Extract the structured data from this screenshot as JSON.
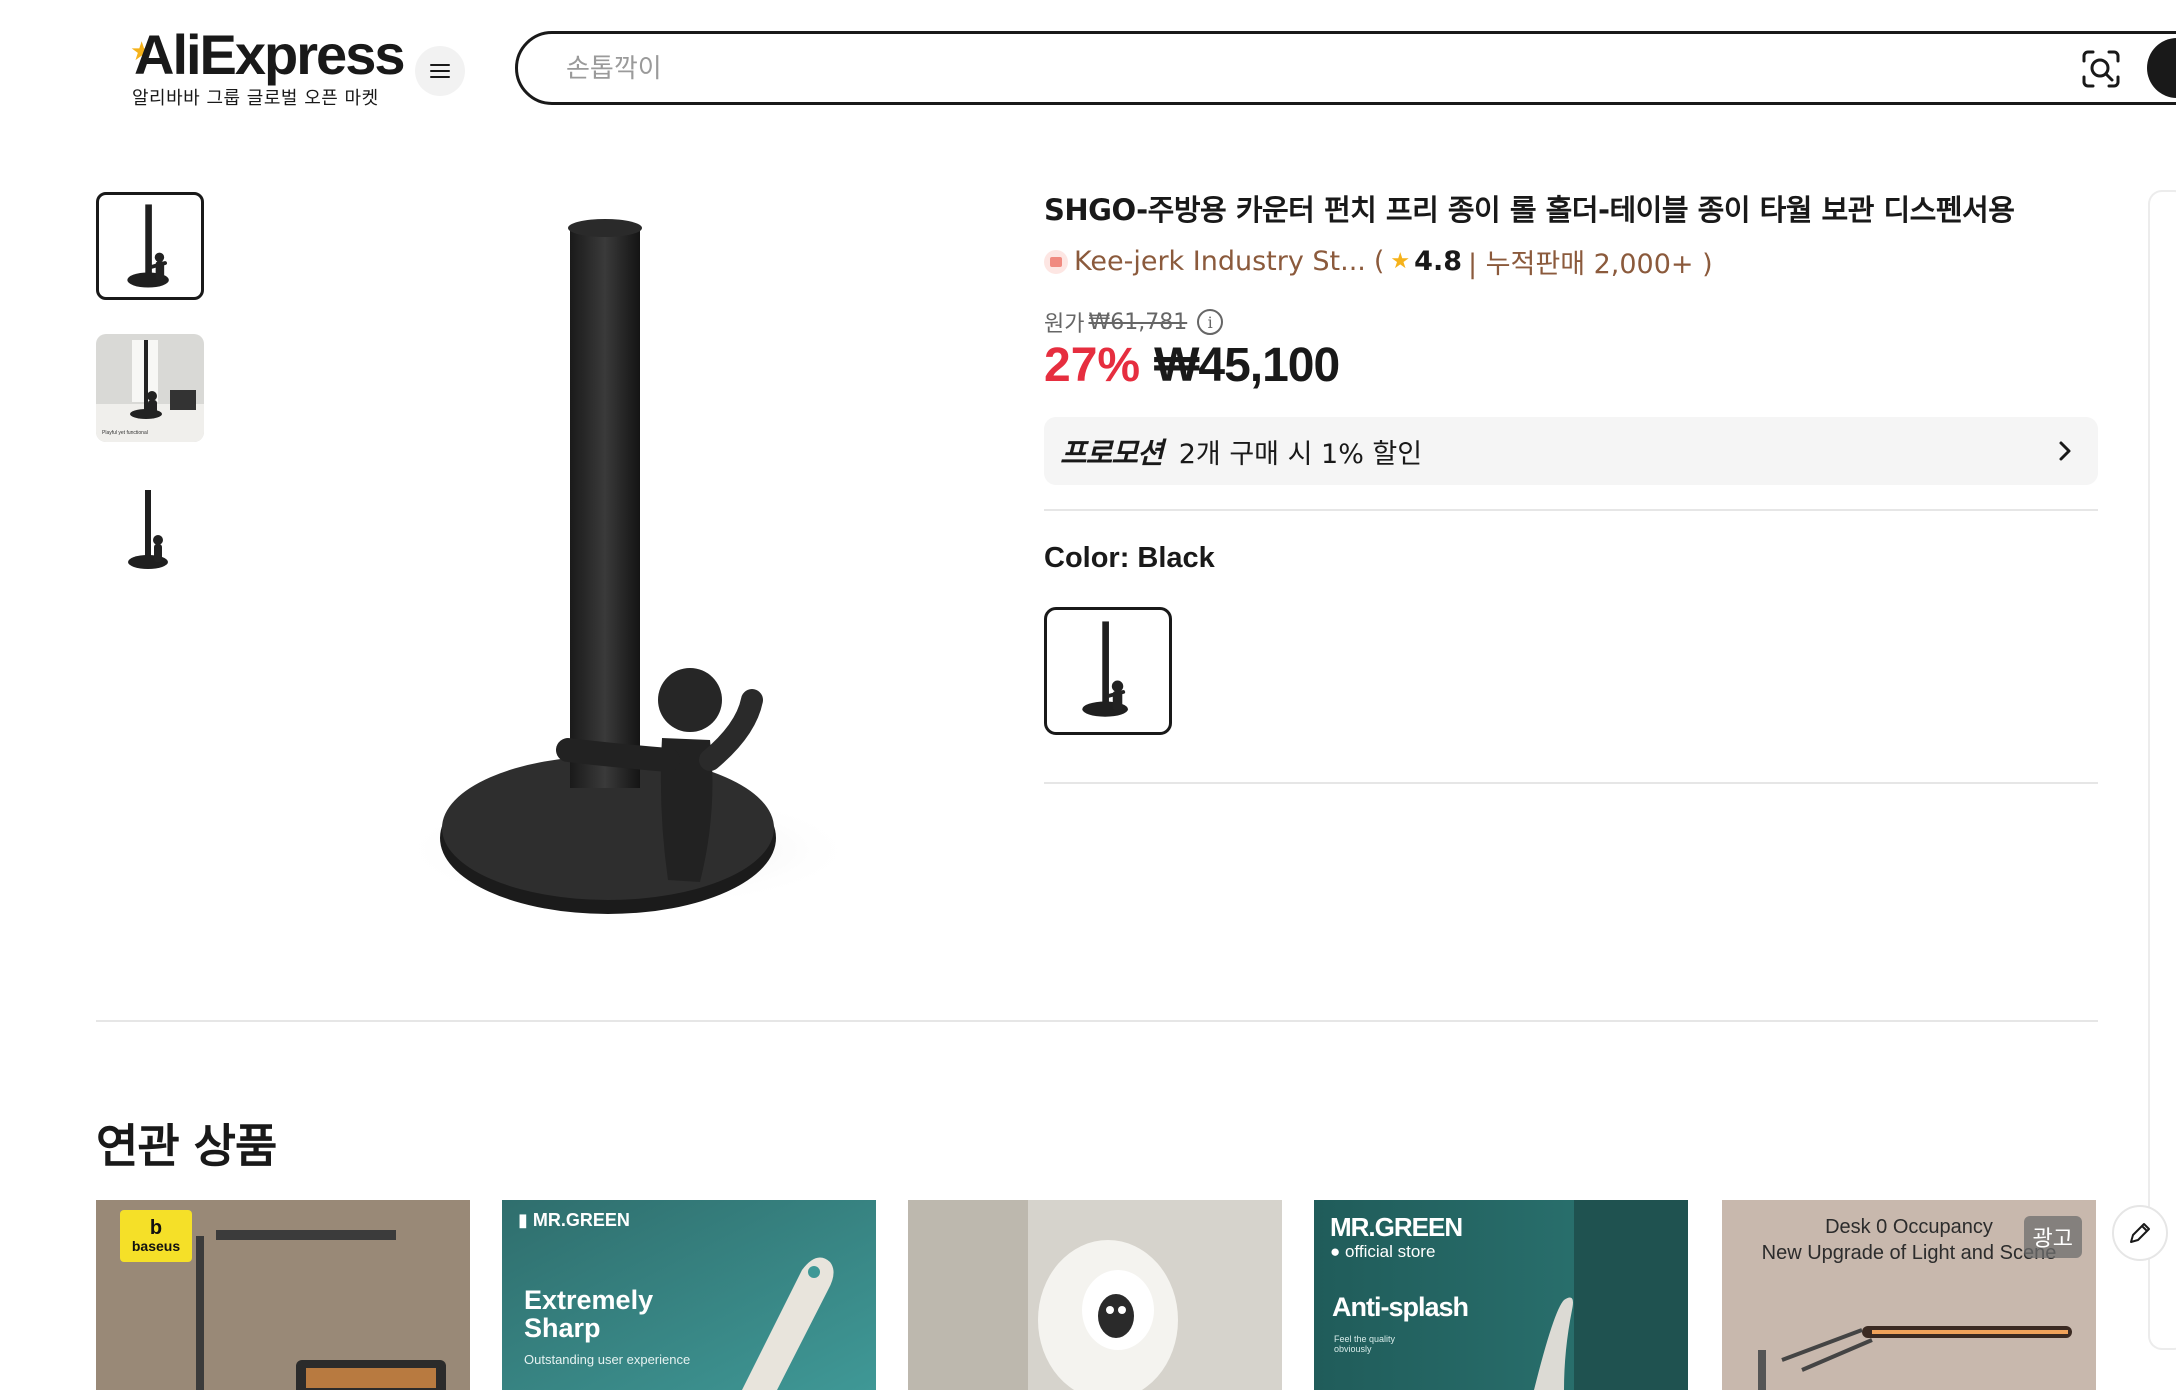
{
  "header": {
    "logo_text": "AliExpress",
    "logo_subtitle": "알리바바 그룹 글로벌 오픈 마켓",
    "menu_icon": "hamburger-menu-icon",
    "search": {
      "placeholder": "손톱깍이",
      "value": ""
    },
    "camera_icon": "image-search-icon"
  },
  "thumbnails": [
    {
      "name": "thumbnail-1",
      "active": true
    },
    {
      "name": "thumbnail-2",
      "active": false,
      "caption": "Playful yet functional"
    },
    {
      "name": "thumbnail-3",
      "active": false
    }
  ],
  "product": {
    "title": "SHGO-주방용 카운터 펀치 프리 종이 롤 홀더-테이블 종이 타월 보관 디스펜서용",
    "store_name": "Kee-jerk Industry St...",
    "store_open_paren": "(",
    "rating": "4.8",
    "sales_text": "| 누적판매 2,000+ )",
    "original_label": "원가",
    "original_price": "₩61,781",
    "discount": "27%",
    "price": "₩45,100",
    "promo_tag": "프로모션",
    "promo_text": "2개 구매 시 1% 할인",
    "color_label": "Color: Black"
  },
  "related": {
    "title": "연관 상품",
    "cards": [
      {
        "brand": "baseus"
      },
      {
        "brand": "MR.GREEN",
        "headline_1": "Extremely",
        "headline_2": "Sharp",
        "sub": "Outstanding user experience"
      },
      {
        "brand": ""
      },
      {
        "brand": "MR.GREEN",
        "brand_sub": "official store",
        "headline_1": "Anti-splash",
        "sub": "Feel the quality obviously"
      },
      {
        "line_1": "Desk 0 Occupancy",
        "line_2": "New Upgrade of Light and Scene",
        "ad_label": "광고"
      }
    ]
  },
  "colors": {
    "accent_red": "#e62e3f",
    "store_brown": "#8b5a3c",
    "star": "#f5b21b",
    "teal_card": "#3a8e8c"
  }
}
